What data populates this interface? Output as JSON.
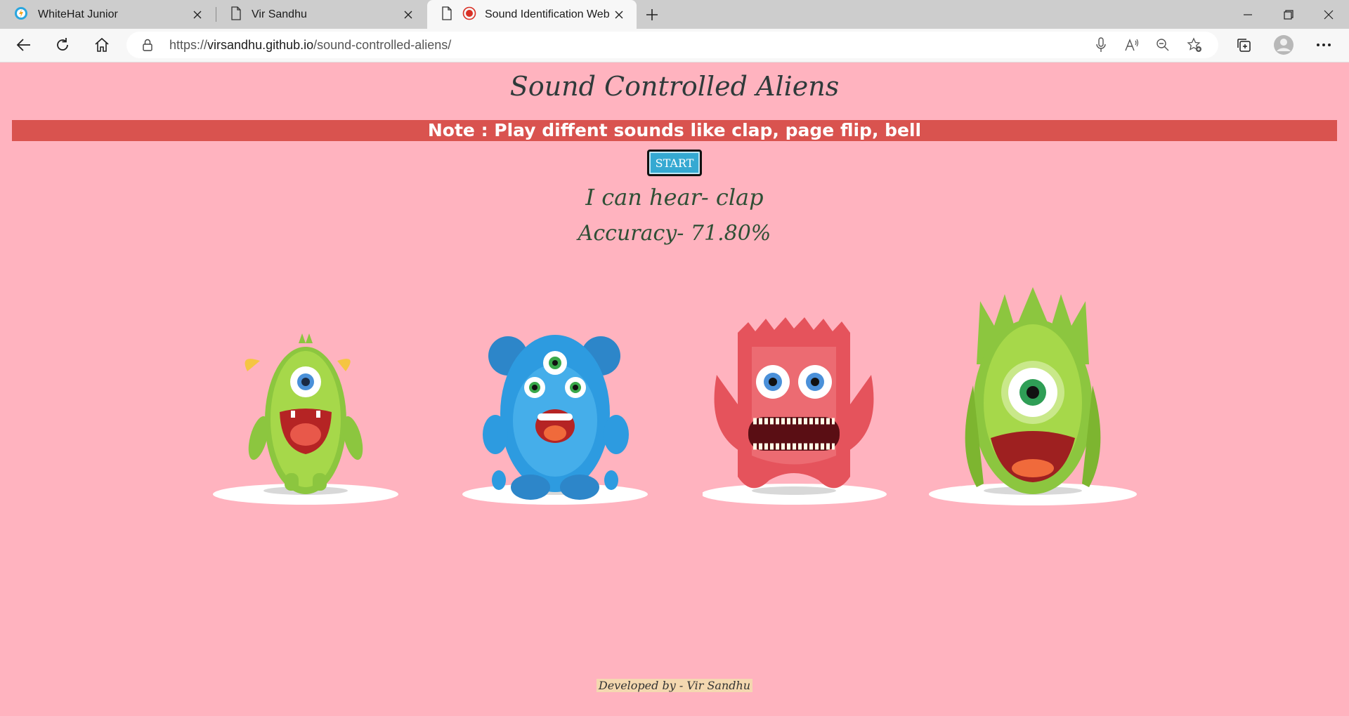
{
  "browser": {
    "tabs": [
      {
        "title": "WhiteHat Junior",
        "icon": "whitehat-favicon-icon",
        "active": false
      },
      {
        "title": "Vir Sandhu",
        "icon": "page-icon",
        "active": false
      },
      {
        "title": "Sound Identification Web A",
        "icon": "page-icon",
        "active": true
      }
    ],
    "address": {
      "prefix": "https://",
      "host": "virsandhu.github.io",
      "path": "/sound-controlled-aliens/"
    }
  },
  "page": {
    "title": "Sound Controlled Aliens",
    "note": "Note : Play diffent sounds like clap, page flip, bell",
    "start_label": "START",
    "hear_text": "I can hear- clap",
    "accuracy_text": "Accuracy- 71.80%",
    "footer": "Developed by - Vir Sandhu"
  },
  "colors": {
    "background": "#ffb3bf",
    "note_bar": "#d9534f",
    "start_button": "#35a9d2",
    "alien_green": "#9acd32",
    "alien_blue": "#2d9be0",
    "alien_red": "#e5535c"
  }
}
